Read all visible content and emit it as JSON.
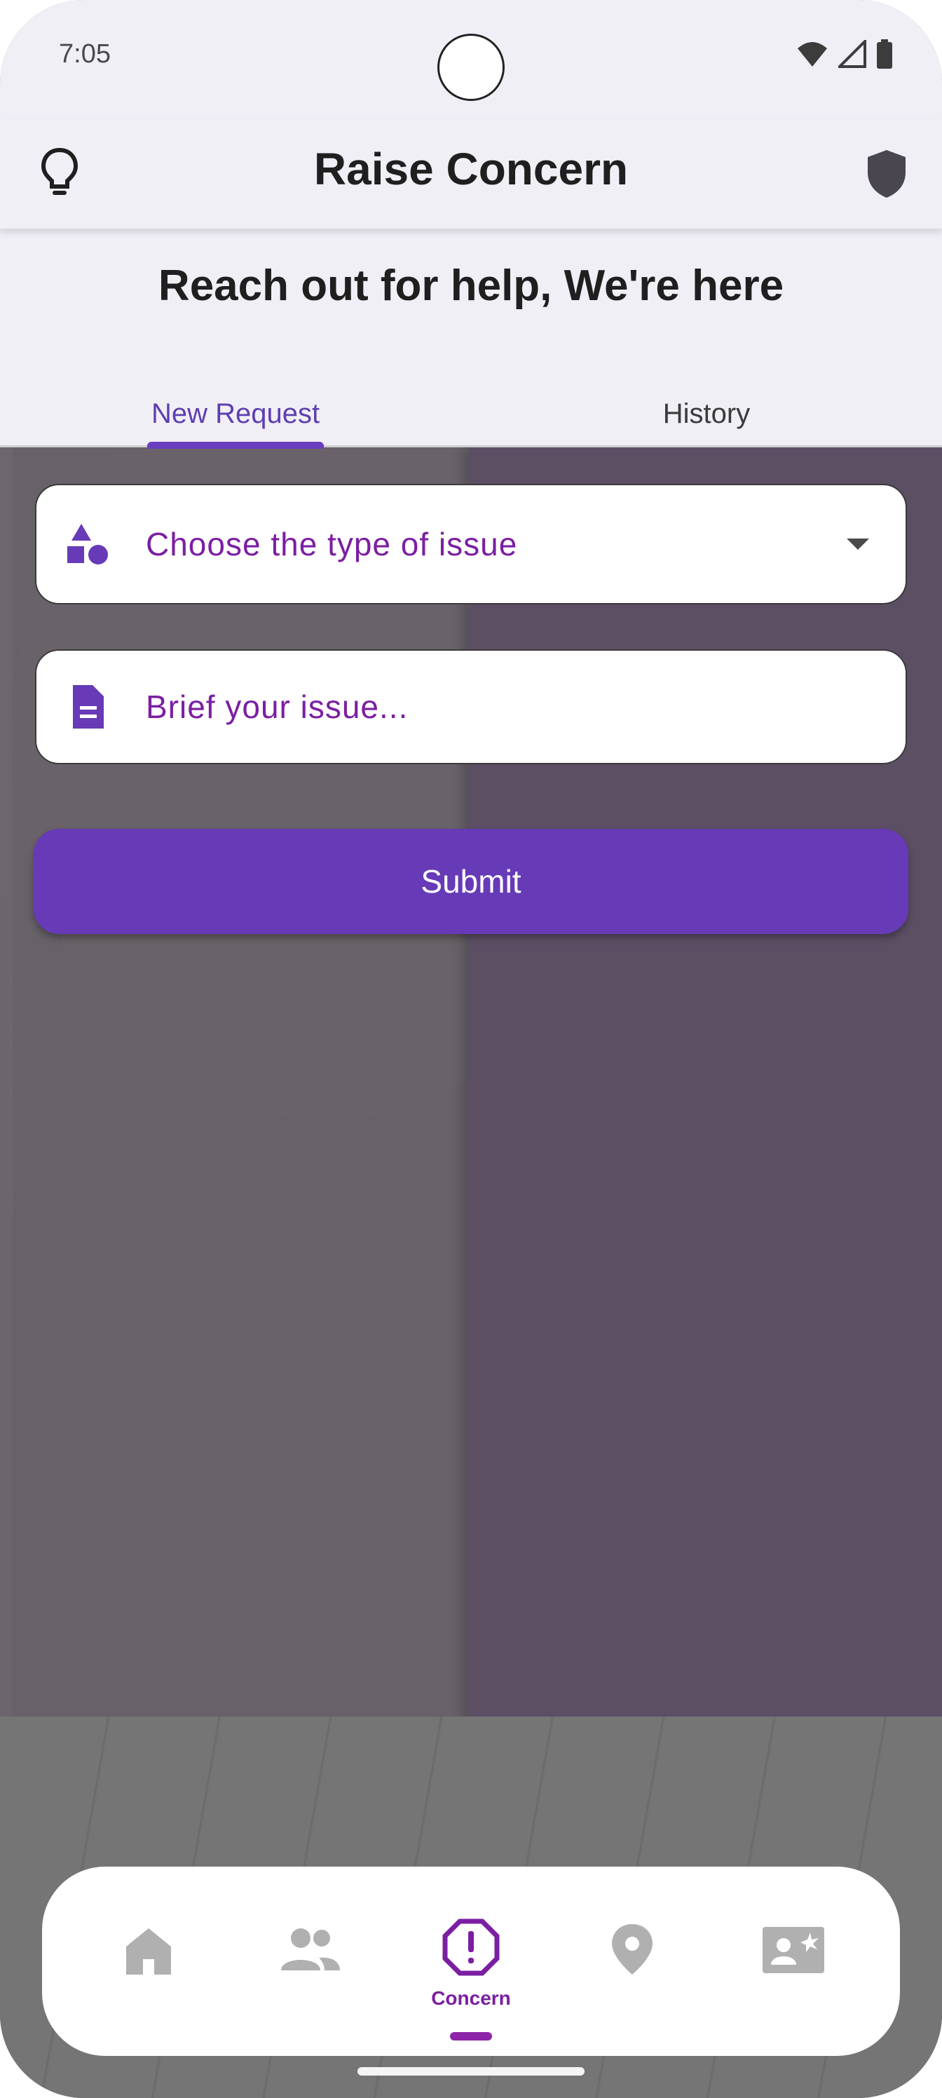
{
  "status_bar": {
    "time": "7:05"
  },
  "app_bar": {
    "title": "Raise Concern",
    "left_icon": "lightbulb-icon",
    "right_icon": "shield-icon"
  },
  "header": {
    "tagline": "Reach out for help, We're here"
  },
  "tabs": [
    {
      "label": "New Request",
      "selected": true
    },
    {
      "label": "History",
      "selected": false
    }
  ],
  "form": {
    "issue_type": {
      "placeholder": "Choose the type of issue",
      "icon": "shapes-icon"
    },
    "description": {
      "placeholder": "Brief your issue...",
      "icon": "document-icon"
    },
    "submit_label": "Submit"
  },
  "bottom_nav": {
    "items": [
      {
        "icon": "home-icon",
        "label": ""
      },
      {
        "icon": "people-icon",
        "label": ""
      },
      {
        "icon": "alert-octagon-icon",
        "label": "Concern",
        "selected": true
      },
      {
        "icon": "location-pin-icon",
        "label": ""
      },
      {
        "icon": "contact-card-icon",
        "label": ""
      }
    ]
  },
  "colors": {
    "accent": "#673ab7",
    "accent_text": "#7b1fa2",
    "surface": "#f1eff6"
  }
}
